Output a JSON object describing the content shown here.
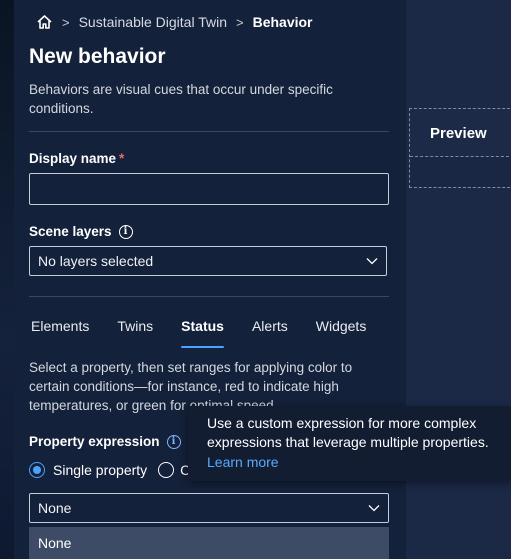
{
  "breadcrumb": {
    "home_icon": "home-icon",
    "items": [
      "Sustainable Digital Twin",
      "Behavior"
    ]
  },
  "page": {
    "title": "New behavior",
    "description": "Behaviors are visual cues that occur under specific conditions."
  },
  "form": {
    "display_name": {
      "label": "Display name",
      "required_mark": "*",
      "value": ""
    },
    "scene_layers": {
      "label": "Scene layers",
      "value": "No layers selected"
    }
  },
  "tabs": [
    {
      "label": "Elements",
      "active": false
    },
    {
      "label": "Twins",
      "active": false
    },
    {
      "label": "Status",
      "active": true
    },
    {
      "label": "Alerts",
      "active": false
    },
    {
      "label": "Widgets",
      "active": false
    }
  ],
  "status": {
    "description": "Select a property, then set ranges for applying color to certain conditions—for instance, red to indicate high temperatures, or green for optimal speed.",
    "property_expression_label": "Property expression",
    "radio_single": "Single property",
    "radio_custom_partial": "C",
    "property_select_value": "None",
    "dropdown_option": "None"
  },
  "tooltip": {
    "text": "Use a custom expression for more complex expressions that leverage multiple properties.",
    "link": "Learn more"
  },
  "preview": {
    "label": "Preview"
  },
  "colors": {
    "accent": "#4ca3ff",
    "panel": "#14213a",
    "required": "#e86a6a"
  }
}
